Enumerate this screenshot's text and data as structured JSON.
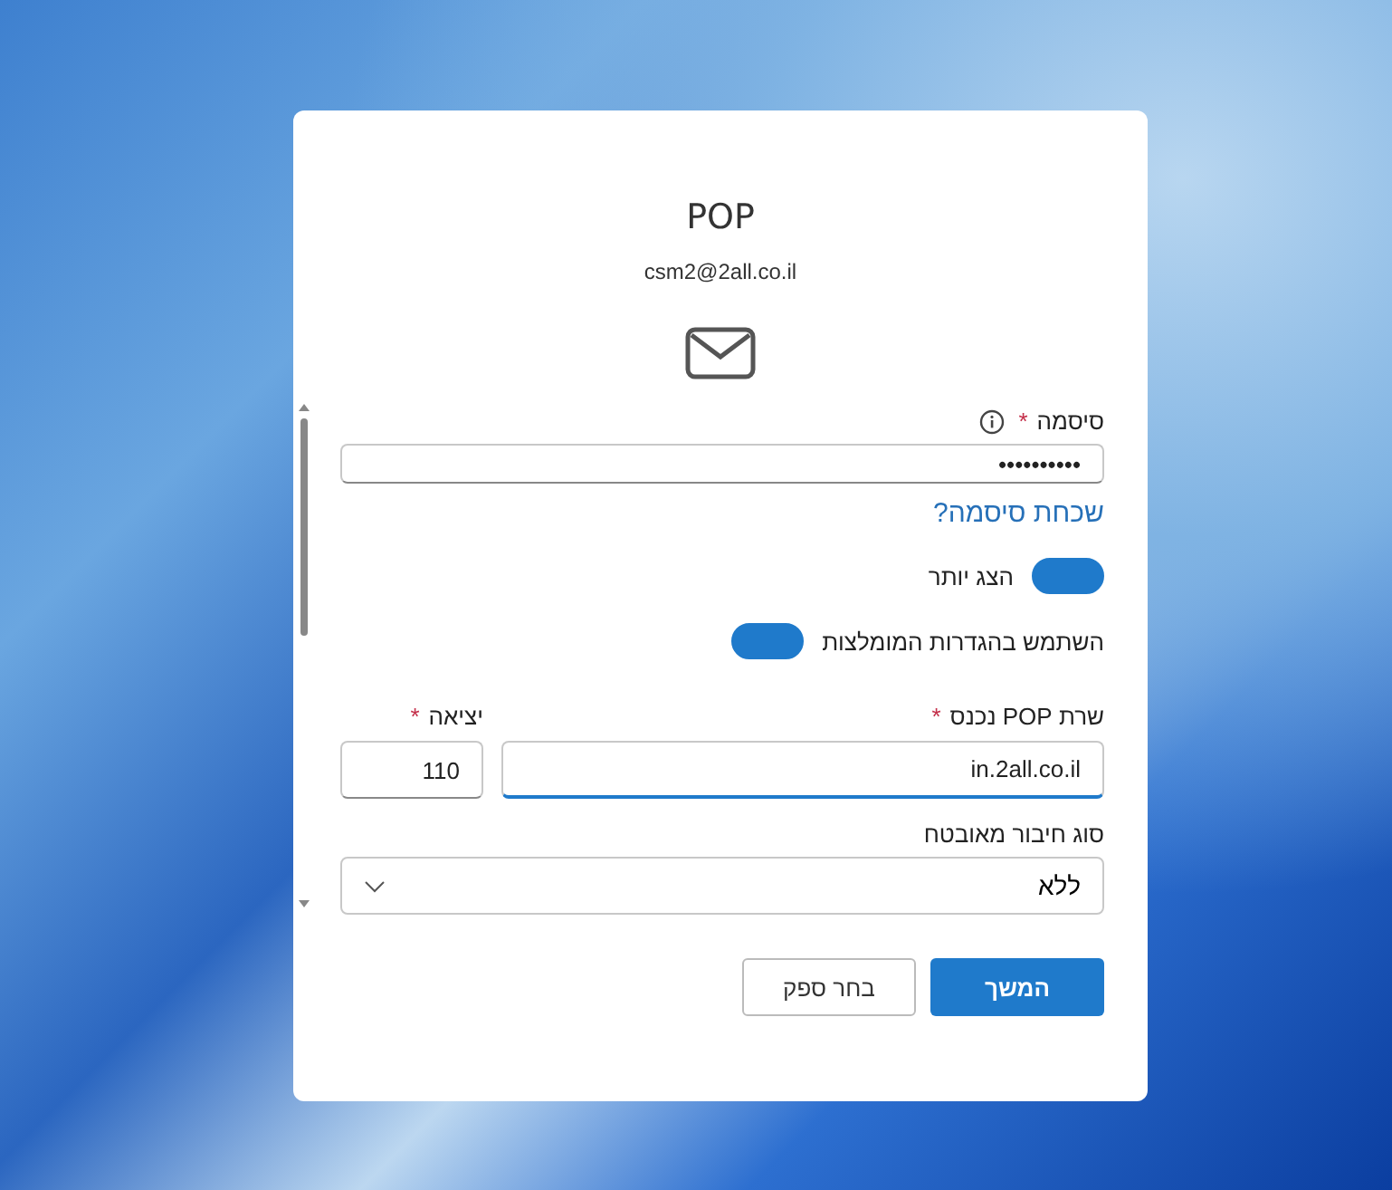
{
  "dialog": {
    "title": "POP",
    "email": "csm2@2all.co.il"
  },
  "password": {
    "label": "סיסמה",
    "required_mark": "*",
    "value": "••••••••••"
  },
  "forgot_link": "שכחת סיסמה?",
  "toggles": [
    {
      "label": "הצג יותר",
      "on": true
    },
    {
      "label": "השתמש בהגדרות המומלצות",
      "on": true
    }
  ],
  "incoming_server": {
    "label": "שרת POP נכנס",
    "required_mark": "*",
    "value": "in.2all.co.il",
    "focused": true
  },
  "port": {
    "label": "יציאה",
    "required_mark": "*",
    "value": "110"
  },
  "security": {
    "label": "סוג חיבור מאובטח",
    "value": "ללא"
  },
  "buttons": [
    {
      "label": "המשך",
      "kind": "primary"
    },
    {
      "label": "בחר ספק",
      "kind": "secondary"
    }
  ]
}
